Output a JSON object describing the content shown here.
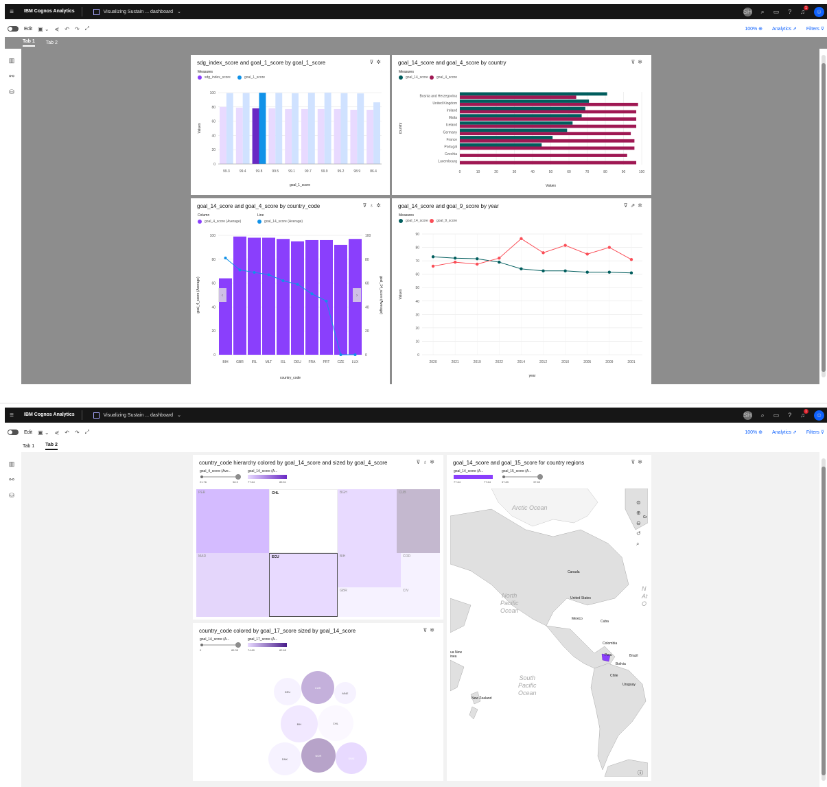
{
  "app": {
    "name": "IBM Cognos Analytics",
    "dashboard_title": "Visualizing Sustain ... dashboard",
    "user_initials": "SH",
    "notification_count": "1"
  },
  "toolbar": {
    "edit_label": "Edit",
    "zoom": "100%",
    "analytics": "Analytics",
    "filters": "Filters"
  },
  "tabs": [
    "Tab 1",
    "Tab 2"
  ],
  "screens": [
    {
      "active_tab": "Tab 1"
    },
    {
      "active_tab": "Tab 2"
    }
  ],
  "widgets": {
    "w1": {
      "title": "sdg_index_score and goal_1_score by goal_1_score",
      "legend_title": "Measures",
      "legend": [
        {
          "name": "sdg_index_score",
          "color": "#8a3ffc"
        },
        {
          "name": "goal_1_score",
          "color": "#1192e8"
        }
      ]
    },
    "w2": {
      "title": "goal_14_score and goal_4_score by country",
      "legend_title": "Measures",
      "legend": [
        {
          "name": "goal_14_score",
          "color": "#005d5d"
        },
        {
          "name": "goal_4_score",
          "color": "#9f1853"
        }
      ]
    },
    "w3": {
      "title": "goal_14_score and goal_4_score by country_code",
      "legend_col_title": "Column",
      "legend_line_title": "Line",
      "legend": [
        {
          "name": "goal_4_score (Average)",
          "color": "#8a3ffc"
        },
        {
          "name": "goal_14_score (Average)",
          "color": "#1192e8"
        }
      ]
    },
    "w4": {
      "title": "goal_14_score and goal_9_score by year",
      "legend_title": "Measures",
      "legend": [
        {
          "name": "goal_14_score",
          "color": "#005d5d"
        },
        {
          "name": "goal_9_score",
          "color": "#fa4d56"
        }
      ]
    },
    "w5": {
      "title": "country_code hierarchy colored by goal_14_score and sized by goal_4_score",
      "size_legend": "goal_4_score (Ave...",
      "color_legend": "goal_14_score (A...",
      "size_min": "21.76",
      "size_max": "98.3",
      "color_min": "77.64",
      "color_max": "85.51",
      "tiles": [
        "PER",
        "CHL",
        "BGH",
        "CUB",
        "ECU",
        "BIH",
        "COD",
        "GBR",
        "CIV",
        "MAR"
      ]
    },
    "w6": {
      "title": "country_code colored by goal_17_score sized by goal_14_score",
      "size_legend": "goal_14_score (A...",
      "color_legend": "goal_17_score (A...",
      "size_min": "0",
      "size_max": "85.35",
      "color_min": "74.80",
      "color_max": "82.65",
      "bubbles": [
        "DEU",
        "CUB",
        "MNE",
        "BIH",
        "CHL",
        "DNK",
        "NOR",
        "SWE"
      ]
    },
    "w7": {
      "title": "goal_14_score and goal_15_score for country regions",
      "color_legend": "goal_14_score (A...",
      "size_legend": "goal_15_score (A...",
      "color_min": "77.64",
      "color_max": "77.64",
      "size_min": "37.89",
      "size_max": "37.89",
      "labels": {
        "arctic": "Arctic Ocean",
        "canada": "Canada",
        "us": "United States",
        "mexico": "Mexico",
        "cuba": "Cuba",
        "colombia": "Colombia",
        "peru": "Peru",
        "brazil": "Brazil",
        "bolivia": "Bolivia",
        "chile": "Chile",
        "uruguay": "Uruguay",
        "nz": "New Zealand",
        "npo": "North\nPacific\nOcean",
        "spo": "South\nPacific\nOcean",
        "nao": "N\nAt\nO",
        "new": "ua New\ninea",
        "gr": "Gr"
      }
    }
  },
  "chart_data": [
    {
      "type": "bar",
      "title": "sdg_index_score and goal_1_score by goal_1_score",
      "categories": [
        "99.3",
        "99.4",
        "99.8",
        "99.5",
        "99.1",
        "99.7",
        "99.9",
        "99.2",
        "98.9",
        "86.4"
      ],
      "series": [
        {
          "name": "sdg_index_score",
          "values": [
            80,
            79,
            78,
            78,
            77,
            77,
            77,
            77,
            76,
            76
          ]
        },
        {
          "name": "goal_1_score",
          "values": [
            99.3,
            99.4,
            99.8,
            99.5,
            99.1,
            99.7,
            99.9,
            99.2,
            98.9,
            86.4
          ]
        }
      ],
      "highlight_index": 2,
      "xlabel": "goal_1_score",
      "ylabel": "Values",
      "ylim": [
        0,
        100
      ],
      "yticks": [
        0,
        20,
        40,
        60,
        80,
        100
      ]
    },
    {
      "type": "bar",
      "orientation": "horizontal",
      "title": "goal_14_score and goal_4_score by country",
      "categories": [
        "Bosnia and Herzegovina",
        "United Kingdom",
        "Ireland",
        "Malta",
        "Iceland",
        "Germany",
        "France",
        "Portugal",
        "Czechia",
        "Luxembourg"
      ],
      "series": [
        {
          "name": "goal_14_score",
          "values": [
            81,
            71,
            69,
            67,
            62,
            59,
            51,
            45,
            0,
            0
          ]
        },
        {
          "name": "goal_4_score",
          "values": [
            64,
            98,
            97,
            97,
            97,
            94,
            96,
            96,
            92,
            97
          ]
        }
      ],
      "xlabel": "Values",
      "ylabel": "country",
      "xlim": [
        0,
        100
      ],
      "xticks": [
        0,
        10,
        20,
        30,
        40,
        50,
        60,
        70,
        80,
        90,
        100
      ]
    },
    {
      "type": "bar",
      "combo": "column+line",
      "title": "goal_14_score and goal_4_score by country_code",
      "categories": [
        "BIH",
        "GBR",
        "IRL",
        "MLT",
        "ISL",
        "DEU",
        "FRA",
        "PRT",
        "CZE",
        "LUX"
      ],
      "series": [
        {
          "name": "goal_4_score (Average)",
          "kind": "column",
          "values": [
            64,
            99,
            98,
            98,
            97,
            95,
            96,
            96,
            92,
            97
          ]
        },
        {
          "name": "goal_14_score (Average)",
          "kind": "line",
          "values": [
            81,
            71,
            69,
            67,
            62,
            59,
            51,
            45,
            0,
            0
          ]
        }
      ],
      "xlabel": "country_code",
      "ylabel": "goal_4_score (Average)",
      "y2label": "goal_14_score (Average)",
      "ylim": [
        0,
        100
      ],
      "yticks": [
        0,
        20,
        40,
        60,
        80,
        100
      ]
    },
    {
      "type": "line",
      "title": "goal_14_score and goal_9_score by year",
      "categories": [
        "2020",
        "2021",
        "2019",
        "2022",
        "2014",
        "2012",
        "2010",
        "2005",
        "2009",
        "2001"
      ],
      "series": [
        {
          "name": "goal_14_score",
          "values": [
            73,
            72,
            71.5,
            69,
            64,
            62.5,
            62.5,
            61.5,
            61.5,
            61
          ]
        },
        {
          "name": "goal_9_score",
          "values": [
            66,
            69,
            67.5,
            72,
            86.5,
            76,
            81.5,
            75,
            80,
            71
          ]
        }
      ],
      "xlabel": "year",
      "ylabel": "Values",
      "ylim": [
        0,
        90
      ],
      "yticks": [
        0,
        10,
        20,
        30,
        40,
        50,
        60,
        70,
        80,
        90
      ]
    }
  ]
}
